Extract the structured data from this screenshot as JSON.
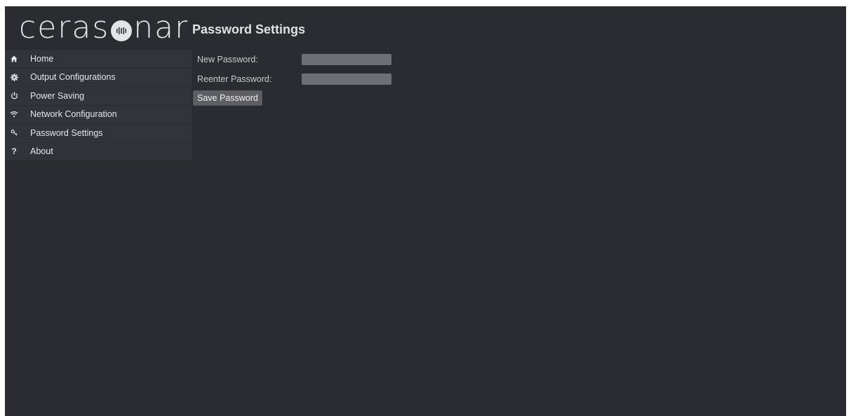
{
  "logo": {
    "text_before": "ceras",
    "text_after": "nar",
    "mark_icon": "sonar-wave-icon"
  },
  "page_title": "Password Settings",
  "sidebar": {
    "items": [
      {
        "label": "Home",
        "icon": "home-icon"
      },
      {
        "label": "Output Configurations",
        "icon": "gear-icon"
      },
      {
        "label": "Power Saving",
        "icon": "power-icon"
      },
      {
        "label": "Network Configuration",
        "icon": "wifi-icon"
      },
      {
        "label": "Password Settings",
        "icon": "key-icon"
      },
      {
        "label": "About",
        "icon": "question-icon",
        "glyph": "?"
      }
    ]
  },
  "form": {
    "new_password_label": "New Password:",
    "new_password_value": "",
    "reenter_password_label": "Reenter Password:",
    "reenter_password_value": "",
    "save_button_label": "Save Password"
  },
  "colors": {
    "background": "#2a2c2f",
    "sidebar_item": "#30333a",
    "input": "#6e6f72",
    "button": "#5e5f62",
    "text": "#e6e7e9"
  }
}
